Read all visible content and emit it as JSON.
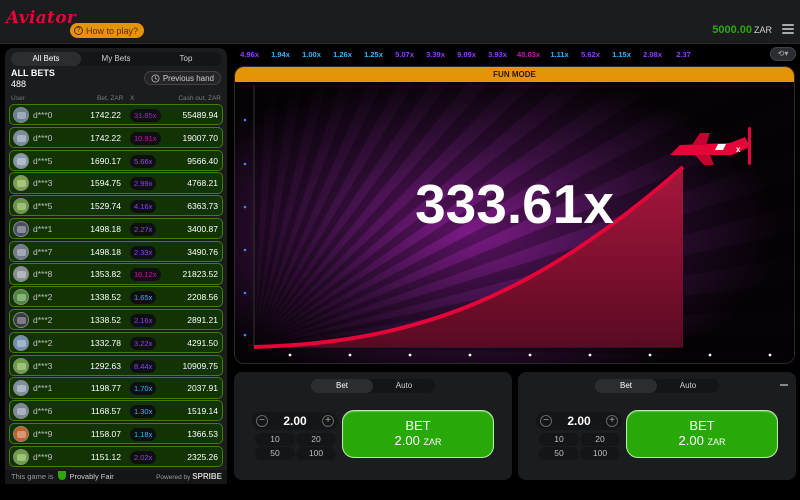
{
  "header": {
    "logo": "Aviator",
    "how_to_play": "How to play?",
    "balance": "5000.00",
    "currency": "ZAR"
  },
  "bets_panel": {
    "tabs": [
      "All Bets",
      "My Bets",
      "Top"
    ],
    "active_tab": 0,
    "title": "ALL BETS",
    "count": "488",
    "previous_hand": "Previous hand",
    "col_user": "User",
    "col_bet": "Bet, ZAR",
    "col_x": "X",
    "col_cashout": "Cash out, ZAR",
    "rows": [
      {
        "user": "d***0",
        "bet": "1742.22",
        "mult": "31.85x",
        "mult_color": "#c017b4",
        "cashout": "55489.94"
      },
      {
        "user": "d***0",
        "bet": "1742.22",
        "mult": "10.91x",
        "mult_color": "#c017b4",
        "cashout": "19007.70"
      },
      {
        "user": "d***5",
        "bet": "1690.17",
        "mult": "5.66x",
        "mult_color": "#913ef8",
        "cashout": "9566.40"
      },
      {
        "user": "d***3",
        "bet": "1594.75",
        "mult": "2.99x",
        "mult_color": "#913ef8",
        "cashout": "4768.21"
      },
      {
        "user": "d***5",
        "bet": "1529.74",
        "mult": "4.16x",
        "mult_color": "#913ef8",
        "cashout": "6363.73"
      },
      {
        "user": "d***1",
        "bet": "1498.18",
        "mult": "2.27x",
        "mult_color": "#913ef8",
        "cashout": "3400.87"
      },
      {
        "user": "d***7",
        "bet": "1498.18",
        "mult": "2.33x",
        "mult_color": "#913ef8",
        "cashout": "3490.76"
      },
      {
        "user": "d***8",
        "bet": "1353.82",
        "mult": "16.12x",
        "mult_color": "#c017b4",
        "cashout": "21823.52"
      },
      {
        "user": "d***2",
        "bet": "1338.52",
        "mult": "1.65x",
        "mult_color": "#34b4ff",
        "cashout": "2208.56"
      },
      {
        "user": "d***2",
        "bet": "1338.52",
        "mult": "2.16x",
        "mult_color": "#913ef8",
        "cashout": "2891.21"
      },
      {
        "user": "d***2",
        "bet": "1332.78",
        "mult": "3.22x",
        "mult_color": "#913ef8",
        "cashout": "4291.50"
      },
      {
        "user": "d***3",
        "bet": "1292.63",
        "mult": "8.44x",
        "mult_color": "#913ef8",
        "cashout": "10909.75"
      },
      {
        "user": "d***1",
        "bet": "1198.77",
        "mult": "1.70x",
        "mult_color": "#34b4ff",
        "cashout": "2037.91"
      },
      {
        "user": "d***6",
        "bet": "1168.57",
        "mult": "1.30x",
        "mult_color": "#34b4ff",
        "cashout": "1519.14"
      },
      {
        "user": "d***9",
        "bet": "1158.07",
        "mult": "1.18x",
        "mult_color": "#34b4ff",
        "cashout": "1366.53"
      },
      {
        "user": "d***9",
        "bet": "1151.12",
        "mult": "2.02x",
        "mult_color": "#913ef8",
        "cashout": "2325.26"
      }
    ],
    "footer_text": "This game is",
    "provably_fair": "Provably Fair",
    "powered_by": "Powered by",
    "spribe": "SPRIBE"
  },
  "history": [
    {
      "v": "4.96x",
      "c": "#913ef8"
    },
    {
      "v": "1.94x",
      "c": "#34b4ff"
    },
    {
      "v": "1.00x",
      "c": "#34b4ff"
    },
    {
      "v": "1.26x",
      "c": "#34b4ff"
    },
    {
      "v": "1.25x",
      "c": "#34b4ff"
    },
    {
      "v": "5.07x",
      "c": "#913ef8"
    },
    {
      "v": "3.39x",
      "c": "#913ef8"
    },
    {
      "v": "9.09x",
      "c": "#913ef8"
    },
    {
      "v": "3.93x",
      "c": "#913ef8"
    },
    {
      "v": "48.03x",
      "c": "#c017b4"
    },
    {
      "v": "1.11x",
      "c": "#34b4ff"
    },
    {
      "v": "5.62x",
      "c": "#913ef8"
    },
    {
      "v": "1.15x",
      "c": "#34b4ff"
    },
    {
      "v": "2.08x",
      "c": "#913ef8"
    },
    {
      "v": "2.37",
      "c": "#913ef8"
    }
  ],
  "game": {
    "fun_mode": "FUN MODE",
    "multiplier": "333.61x",
    "curve_color": "#e50539",
    "accent_color": "#e59407"
  },
  "bet_panels": [
    {
      "tabs": [
        "Bet",
        "Auto"
      ],
      "amount": "2.00",
      "chips": [
        "10",
        "20",
        "50",
        "100"
      ],
      "button_line1": "BET",
      "button_amount": "2.00",
      "button_currency": "ZAR"
    },
    {
      "tabs": [
        "Bet",
        "Auto"
      ],
      "amount": "2.00",
      "chips": [
        "10",
        "20",
        "50",
        "100"
      ],
      "button_line1": "BET",
      "button_amount": "2.00",
      "button_currency": "ZAR"
    }
  ]
}
